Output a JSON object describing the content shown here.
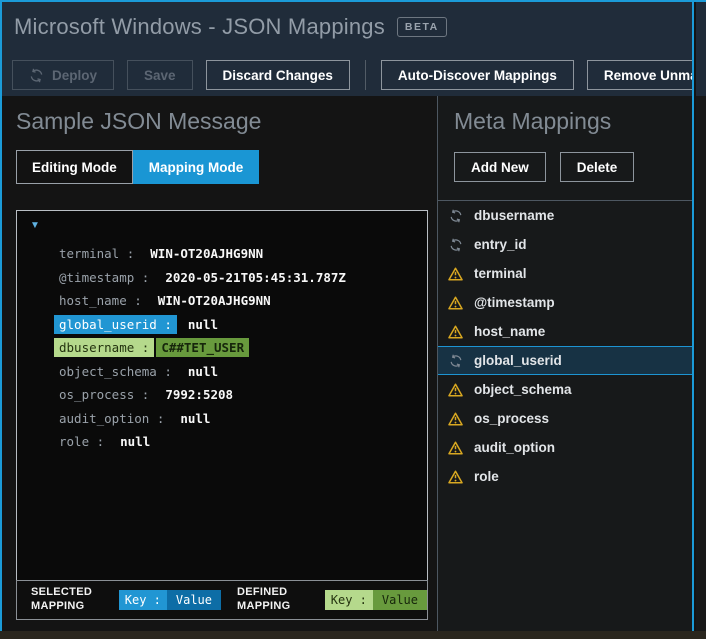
{
  "colors": {
    "accent_blue": "#1e96d4",
    "frame_blue": "#1b9bd8",
    "header_bg": "#202c3a",
    "warning_yellow": "#d9a821",
    "selected_key_bg": "#2196d3",
    "selected_value_bg": "#0d6da6",
    "defined_key_bg": "#b5d98c",
    "defined_value_bg": "#689a3d",
    "selected_row_bg": "#173244"
  },
  "header": {
    "title": "Microsoft Windows - JSON Mappings",
    "beta_badge": "BETA"
  },
  "toolbar": {
    "deploy": "Deploy",
    "save": "Save",
    "discard": "Discard Changes",
    "auto_discover": "Auto-Discover Mappings",
    "remove_unmapped": "Remove Unmapped"
  },
  "sample_json": {
    "title": "Sample JSON Message",
    "editing_mode": "Editing Mode",
    "mapping_mode": "Mapping Mode",
    "collapse_icon": "▼",
    "entries": [
      {
        "key": "terminal :",
        "value": "WIN-OT20AJHG9NN",
        "highlight": "none"
      },
      {
        "key": "@timestamp :",
        "value": "2020-05-21T05:45:31.787Z",
        "highlight": "none"
      },
      {
        "key": "host_name :",
        "value": "WIN-OT20AJHG9NN",
        "highlight": "none"
      },
      {
        "key": "global_userid :",
        "value": "null",
        "highlight": "selected"
      },
      {
        "key": "dbusername :",
        "value": "C##TET_USER",
        "highlight": "defined"
      },
      {
        "key": "object_schema :",
        "value": "null",
        "highlight": "none"
      },
      {
        "key": "os_process :",
        "value": "7992:5208",
        "highlight": "none"
      },
      {
        "key": "audit_option :",
        "value": "null",
        "highlight": "none"
      },
      {
        "key": "role :",
        "value": "null",
        "highlight": "none"
      }
    ],
    "legend": {
      "selected_label": "SELECTED MAPPING",
      "defined_label": "DEFINED MAPPING",
      "key_label": "Key :",
      "value_label": "Value"
    }
  },
  "meta_mappings": {
    "title": "Meta Mappings",
    "add_new": "Add New",
    "delete": "Delete",
    "items": [
      {
        "label": "dbusername",
        "status": "mapped",
        "selected": false
      },
      {
        "label": "entry_id",
        "status": "mapped",
        "selected": false
      },
      {
        "label": "terminal",
        "status": "unmapped",
        "selected": false
      },
      {
        "label": "@timestamp",
        "status": "unmapped",
        "selected": false
      },
      {
        "label": "host_name",
        "status": "unmapped",
        "selected": false
      },
      {
        "label": "global_userid",
        "status": "mapped",
        "selected": true
      },
      {
        "label": "object_schema",
        "status": "unmapped",
        "selected": false
      },
      {
        "label": "os_process",
        "status": "unmapped",
        "selected": false
      },
      {
        "label": "audit_option",
        "status": "unmapped",
        "selected": false
      },
      {
        "label": "role",
        "status": "unmapped",
        "selected": false
      }
    ]
  }
}
